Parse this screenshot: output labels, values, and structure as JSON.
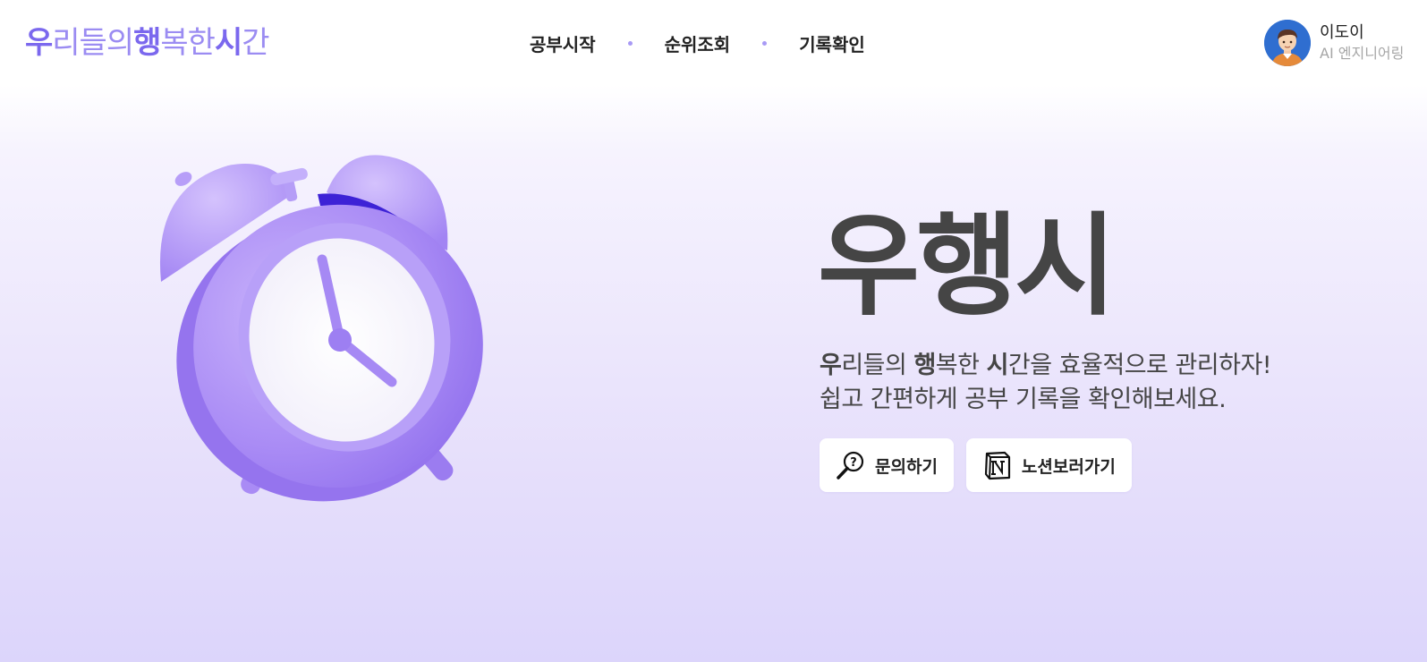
{
  "header": {
    "logo": [
      {
        "text": "우",
        "bold": true
      },
      {
        "text": "리들의",
        "bold": false
      },
      {
        "text": "행",
        "bold": true
      },
      {
        "text": "복한",
        "bold": false
      },
      {
        "text": "시",
        "bold": true
      },
      {
        "text": "간",
        "bold": false
      }
    ],
    "nav": [
      "공부시작",
      "순위조회",
      "기록확인"
    ],
    "profile": {
      "name": "이도이",
      "role": "AI 엔지니어링"
    }
  },
  "hero": {
    "title": "우행시",
    "desc_line1": [
      {
        "text": "우",
        "bold": true
      },
      {
        "text": "리들의 ",
        "bold": false
      },
      {
        "text": "행",
        "bold": true
      },
      {
        "text": "복한 ",
        "bold": false
      },
      {
        "text": "시",
        "bold": true
      },
      {
        "text": "간을 효율적으로 관리하자!",
        "bold": false
      }
    ],
    "desc_line2": "쉽고 간편하게 공부 기록을 확인해보세요.",
    "buttons": {
      "inquiry": "문의하기",
      "notion": "노션보러가기"
    }
  },
  "colors": {
    "accent": "#7b68ee",
    "accent_light": "#9b8cf2",
    "clock_purple": "#a98bf5",
    "text_dark": "#454545"
  },
  "icons": [
    "alarm-clock-illustration",
    "magnifier-question-icon",
    "notion-icon",
    "avatar"
  ]
}
